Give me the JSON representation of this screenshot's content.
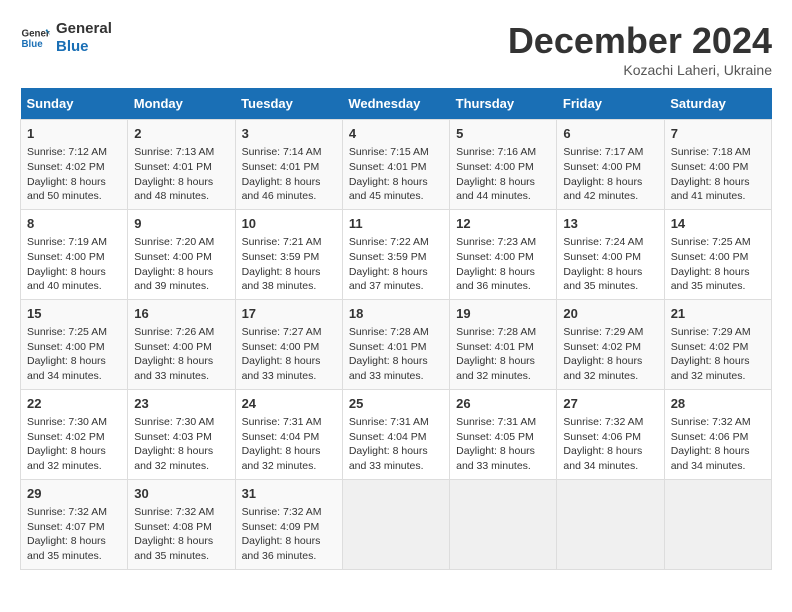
{
  "logo": {
    "line1": "General",
    "line2": "Blue"
  },
  "title": "December 2024",
  "subtitle": "Kozachi Laheri, Ukraine",
  "days_header": [
    "Sunday",
    "Monday",
    "Tuesday",
    "Wednesday",
    "Thursday",
    "Friday",
    "Saturday"
  ],
  "weeks": [
    [
      {
        "day": "1",
        "info": "Sunrise: 7:12 AM\nSunset: 4:02 PM\nDaylight: 8 hours\nand 50 minutes."
      },
      {
        "day": "2",
        "info": "Sunrise: 7:13 AM\nSunset: 4:01 PM\nDaylight: 8 hours\nand 48 minutes."
      },
      {
        "day": "3",
        "info": "Sunrise: 7:14 AM\nSunset: 4:01 PM\nDaylight: 8 hours\nand 46 minutes."
      },
      {
        "day": "4",
        "info": "Sunrise: 7:15 AM\nSunset: 4:01 PM\nDaylight: 8 hours\nand 45 minutes."
      },
      {
        "day": "5",
        "info": "Sunrise: 7:16 AM\nSunset: 4:00 PM\nDaylight: 8 hours\nand 44 minutes."
      },
      {
        "day": "6",
        "info": "Sunrise: 7:17 AM\nSunset: 4:00 PM\nDaylight: 8 hours\nand 42 minutes."
      },
      {
        "day": "7",
        "info": "Sunrise: 7:18 AM\nSunset: 4:00 PM\nDaylight: 8 hours\nand 41 minutes."
      }
    ],
    [
      {
        "day": "8",
        "info": "Sunrise: 7:19 AM\nSunset: 4:00 PM\nDaylight: 8 hours\nand 40 minutes."
      },
      {
        "day": "9",
        "info": "Sunrise: 7:20 AM\nSunset: 4:00 PM\nDaylight: 8 hours\nand 39 minutes."
      },
      {
        "day": "10",
        "info": "Sunrise: 7:21 AM\nSunset: 3:59 PM\nDaylight: 8 hours\nand 38 minutes."
      },
      {
        "day": "11",
        "info": "Sunrise: 7:22 AM\nSunset: 3:59 PM\nDaylight: 8 hours\nand 37 minutes."
      },
      {
        "day": "12",
        "info": "Sunrise: 7:23 AM\nSunset: 4:00 PM\nDaylight: 8 hours\nand 36 minutes."
      },
      {
        "day": "13",
        "info": "Sunrise: 7:24 AM\nSunset: 4:00 PM\nDaylight: 8 hours\nand 35 minutes."
      },
      {
        "day": "14",
        "info": "Sunrise: 7:25 AM\nSunset: 4:00 PM\nDaylight: 8 hours\nand 35 minutes."
      }
    ],
    [
      {
        "day": "15",
        "info": "Sunrise: 7:25 AM\nSunset: 4:00 PM\nDaylight: 8 hours\nand 34 minutes."
      },
      {
        "day": "16",
        "info": "Sunrise: 7:26 AM\nSunset: 4:00 PM\nDaylight: 8 hours\nand 33 minutes."
      },
      {
        "day": "17",
        "info": "Sunrise: 7:27 AM\nSunset: 4:00 PM\nDaylight: 8 hours\nand 33 minutes."
      },
      {
        "day": "18",
        "info": "Sunrise: 7:28 AM\nSunset: 4:01 PM\nDaylight: 8 hours\nand 33 minutes."
      },
      {
        "day": "19",
        "info": "Sunrise: 7:28 AM\nSunset: 4:01 PM\nDaylight: 8 hours\nand 32 minutes."
      },
      {
        "day": "20",
        "info": "Sunrise: 7:29 AM\nSunset: 4:02 PM\nDaylight: 8 hours\nand 32 minutes."
      },
      {
        "day": "21",
        "info": "Sunrise: 7:29 AM\nSunset: 4:02 PM\nDaylight: 8 hours\nand 32 minutes."
      }
    ],
    [
      {
        "day": "22",
        "info": "Sunrise: 7:30 AM\nSunset: 4:02 PM\nDaylight: 8 hours\nand 32 minutes."
      },
      {
        "day": "23",
        "info": "Sunrise: 7:30 AM\nSunset: 4:03 PM\nDaylight: 8 hours\nand 32 minutes."
      },
      {
        "day": "24",
        "info": "Sunrise: 7:31 AM\nSunset: 4:04 PM\nDaylight: 8 hours\nand 32 minutes."
      },
      {
        "day": "25",
        "info": "Sunrise: 7:31 AM\nSunset: 4:04 PM\nDaylight: 8 hours\nand 33 minutes."
      },
      {
        "day": "26",
        "info": "Sunrise: 7:31 AM\nSunset: 4:05 PM\nDaylight: 8 hours\nand 33 minutes."
      },
      {
        "day": "27",
        "info": "Sunrise: 7:32 AM\nSunset: 4:06 PM\nDaylight: 8 hours\nand 34 minutes."
      },
      {
        "day": "28",
        "info": "Sunrise: 7:32 AM\nSunset: 4:06 PM\nDaylight: 8 hours\nand 34 minutes."
      }
    ],
    [
      {
        "day": "29",
        "info": "Sunrise: 7:32 AM\nSunset: 4:07 PM\nDaylight: 8 hours\nand 35 minutes."
      },
      {
        "day": "30",
        "info": "Sunrise: 7:32 AM\nSunset: 4:08 PM\nDaylight: 8 hours\nand 35 minutes."
      },
      {
        "day": "31",
        "info": "Sunrise: 7:32 AM\nSunset: 4:09 PM\nDaylight: 8 hours\nand 36 minutes."
      },
      {
        "day": "",
        "info": ""
      },
      {
        "day": "",
        "info": ""
      },
      {
        "day": "",
        "info": ""
      },
      {
        "day": "",
        "info": ""
      }
    ]
  ]
}
